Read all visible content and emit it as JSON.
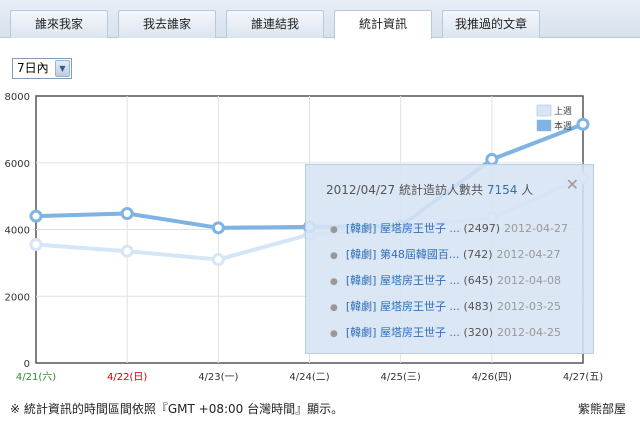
{
  "tabs": [
    {
      "label": "誰來我家",
      "active": false
    },
    {
      "label": "我去誰家",
      "active": false
    },
    {
      "label": "誰連結我",
      "active": false
    },
    {
      "label": "統計資訊",
      "active": true
    },
    {
      "label": "我推過的文章",
      "active": false
    }
  ],
  "range_select": {
    "value": "7日內"
  },
  "chart_data": {
    "type": "line",
    "categories": [
      "4/21(六)",
      "4/22(日)",
      "4/23(一)",
      "4/24(二)",
      "4/25(三)",
      "4/26(四)",
      "4/27(五)"
    ],
    "category_colors": [
      "#2e8b2e",
      "#cc0000",
      "#333333",
      "#333333",
      "#333333",
      "#333333",
      "#333333"
    ],
    "ylim": [
      0,
      8000
    ],
    "yticks": [
      0,
      2000,
      4000,
      6000,
      8000
    ],
    "grid": true,
    "legend_position": "top-right",
    "series": [
      {
        "name": "上週",
        "color": "#d5e6f7",
        "values": [
          3550,
          3350,
          3100,
          3850,
          4050,
          4350,
          5550
        ]
      },
      {
        "name": "本週",
        "color": "#7fb3e4",
        "values": [
          4400,
          4480,
          4050,
          4080,
          4100,
          6100,
          7154
        ]
      }
    ]
  },
  "popup": {
    "date": "2012/04/27",
    "prefix": "統計造訪人數共",
    "count": "7154",
    "suffix": "人",
    "close": "✕",
    "items": [
      {
        "title": "[韓劇] 屋塔房王世子 ...",
        "count": "(2497)",
        "date": "2012-04-27"
      },
      {
        "title": "[韓劇] 第48屆韓國百...",
        "count": "(742)",
        "date": "2012-04-27"
      },
      {
        "title": "[韓劇] 屋塔房王世子 ...",
        "count": "(645)",
        "date": "2012-04-08"
      },
      {
        "title": "[韓劇] 屋塔房王世子 ...",
        "count": "(483)",
        "date": "2012-03-25"
      },
      {
        "title": "[韓劇] 屋塔房王世子 ...",
        "count": "(320)",
        "date": "2012-04-25"
      }
    ]
  },
  "footer": {
    "note": "※ 統計資訊的時間區間依照『GMT +08:00 台灣時間』顯示。",
    "brand": "紫熊部屋"
  }
}
